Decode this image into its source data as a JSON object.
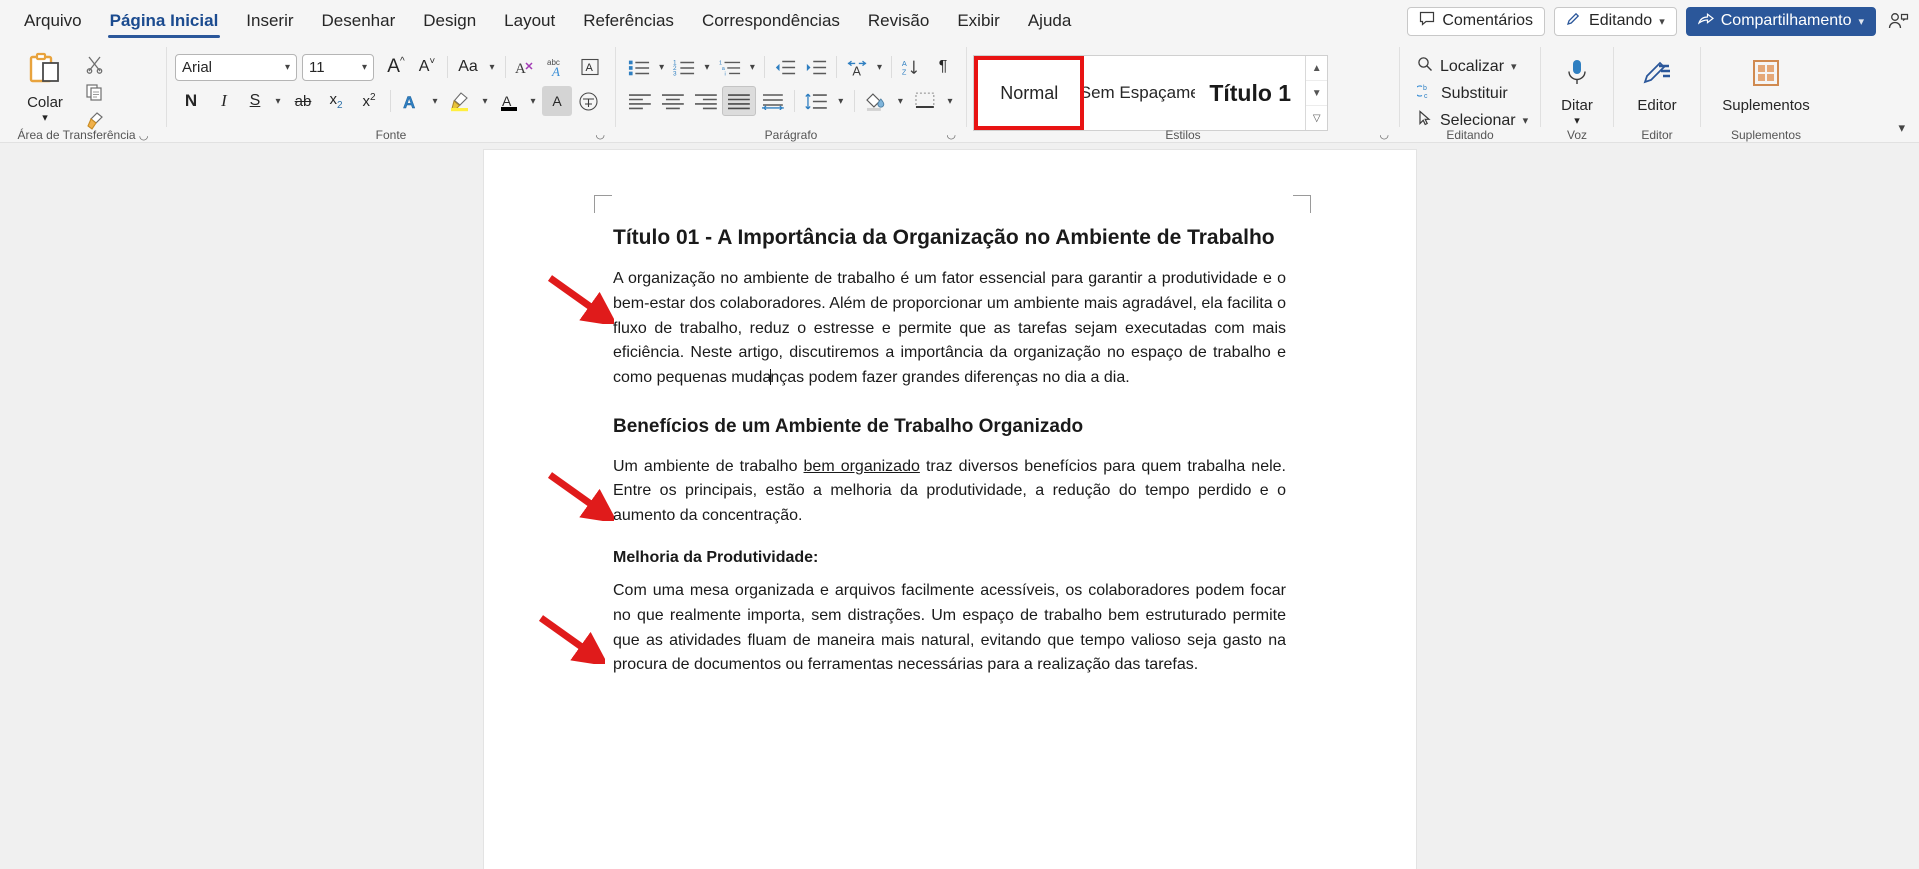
{
  "tabs": [
    {
      "label": "Arquivo",
      "active": false
    },
    {
      "label": "Página Inicial",
      "active": true
    },
    {
      "label": "Inserir",
      "active": false
    },
    {
      "label": "Desenhar",
      "active": false
    },
    {
      "label": "Design",
      "active": false
    },
    {
      "label": "Layout",
      "active": false
    },
    {
      "label": "Referências",
      "active": false
    },
    {
      "label": "Correspondências",
      "active": false
    },
    {
      "label": "Revisão",
      "active": false
    },
    {
      "label": "Exibir",
      "active": false
    },
    {
      "label": "Ajuda",
      "active": false
    }
  ],
  "titlebar_right": {
    "comments_label": "Comentários",
    "editing_label": "Editando",
    "share_label": "Compartilhamento",
    "share_bg": "#2b579a"
  },
  "ribbon": {
    "clipboard": {
      "group_label": "Área de Transferência",
      "paste_label": "Colar",
      "cut_name": "Recortar",
      "copy_name": "Copiar",
      "format_painter_name": "Pincel de Formatação"
    },
    "font": {
      "group_label": "Fonte",
      "font_name": "Arial",
      "font_size": "11",
      "grow_label": "A",
      "shrink_label": "A",
      "case_label": "Aa",
      "clear_label": "A",
      "bold_label": "N",
      "italic_label": "I",
      "underline_label": "S",
      "strike_label": "ab",
      "subscript_label": "x",
      "superscript_label": "x",
      "text_effects_label": "A",
      "highlight_label": "A",
      "fontcolor_label": "A",
      "charshading_label": "A"
    },
    "paragraph": {
      "group_label": "Parágrafo",
      "align_selected": "justificar"
    },
    "styles": {
      "group_label": "Estilos",
      "items": [
        {
          "label": "Normal",
          "selected": true
        },
        {
          "label": "Sem Espaçame",
          "selected": false
        },
        {
          "label": "Título 1",
          "selected": false
        }
      ],
      "highlight_color": "#e81313"
    },
    "editing": {
      "group_label": "Editando",
      "find_label": "Localizar",
      "replace_label": "Substituir",
      "select_label": "Selecionar"
    },
    "voice": {
      "group_label": "Voz",
      "dictate_label": "Ditar"
    },
    "editor": {
      "group_label": "Editor",
      "editor_label": "Editor"
    },
    "addins": {
      "group_label": "Suplementos",
      "addins_label": "Suplementos"
    }
  },
  "document": {
    "title": "Título 01 - A Importância da Organização no Ambiente de Trabalho",
    "paragraph1_before_caret": "A organização no ambiente de trabalho é um fator essencial para garantir a produtividade e o bem-estar dos colaboradores. Além de proporcionar um ambiente mais agradável, ela facilita o fluxo de trabalho, reduz o estresse e permite que as tarefas sejam executadas com mais eficiência. Neste artigo, discutiremos a importância da organização no espaço de trabalho e como pequenas muda",
    "paragraph1_after_caret": "nças podem fazer grandes diferenças no dia a dia.",
    "heading2": "Benefícios de um Ambiente de Trabalho Organizado",
    "paragraph2_part1": "Um ambiente de trabalho ",
    "paragraph2_underlined": "bem organizado",
    "paragraph2_part2": " traz diversos benefícios para quem trabalha nele. Entre os principais, estão a melhoria da produtividade, a redução do tempo perdido e o aumento da concentração.",
    "heading3": "Melhoria da Produtividade:",
    "paragraph3": "Com uma mesa organizada e arquivos facilmente acessíveis, os colaboradores podem focar no que realmente importa, sem distrações. Um espaço de trabalho bem estruturado permite que as atividades fluam de maneira mais natural, evitando que tempo valioso seja gasto na procura de documentos ou ferramentas necessárias para a realização das tarefas.",
    "annotation_arrow_color": "#e01b1b",
    "annotation_arrow_count": 3
  }
}
